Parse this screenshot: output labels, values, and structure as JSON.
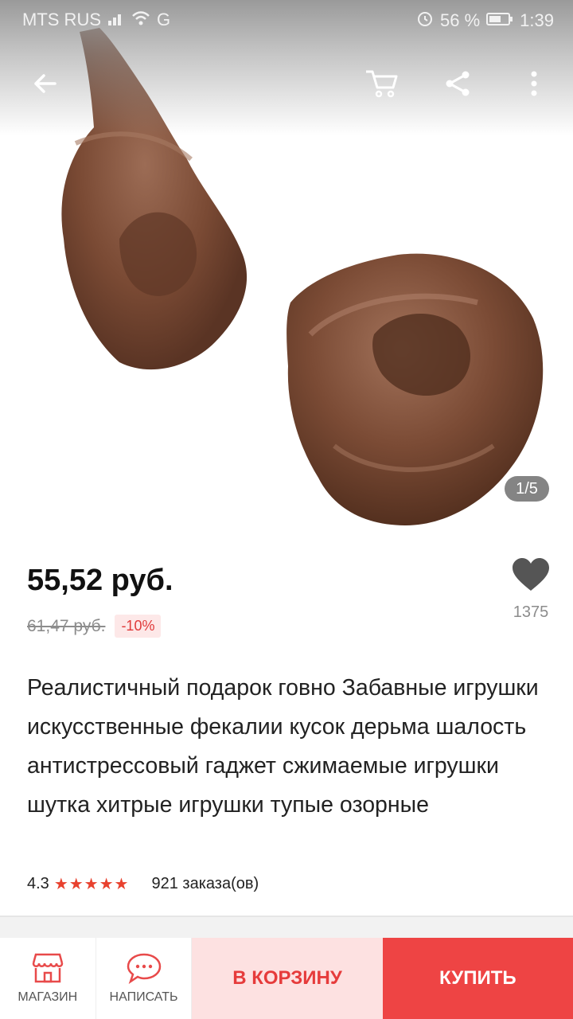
{
  "status_bar": {
    "carrier": "MTS RUS",
    "network": "G",
    "battery": "56 %",
    "time": "1:39"
  },
  "icons": {
    "back": "arrow-left-icon",
    "cart": "cart-icon",
    "share": "share-icon",
    "more": "more-vert-icon",
    "favorite": "heart-icon",
    "shop": "store-icon",
    "message": "chat-icon"
  },
  "gallery": {
    "pager": "1/5"
  },
  "product": {
    "price": "55,52 руб.",
    "old_price": "61,47 руб.",
    "discount": "-10%",
    "favorites_count": "1375",
    "title": "Реалистичный подарок говно Забавные игрушки искусственные фекалии кусок дерьма шалость антистрессовый гаджет сжимаемые игрушки шутка хитрые игрушки тупые озорные",
    "rating": "4.3",
    "stars": "★★★★★",
    "orders": "921 заказа(ов)"
  },
  "bottom_bar": {
    "shop_label": "МАГАЗИН",
    "message_label": "НАПИСАТЬ",
    "add_to_cart_label": "В КОРЗИНУ",
    "buy_label": "КУПИТЬ"
  },
  "colors": {
    "accent": "#ee4444",
    "accent_light": "#fde1e1",
    "star": "#e8412e",
    "product_brown": "#7a4a34"
  }
}
